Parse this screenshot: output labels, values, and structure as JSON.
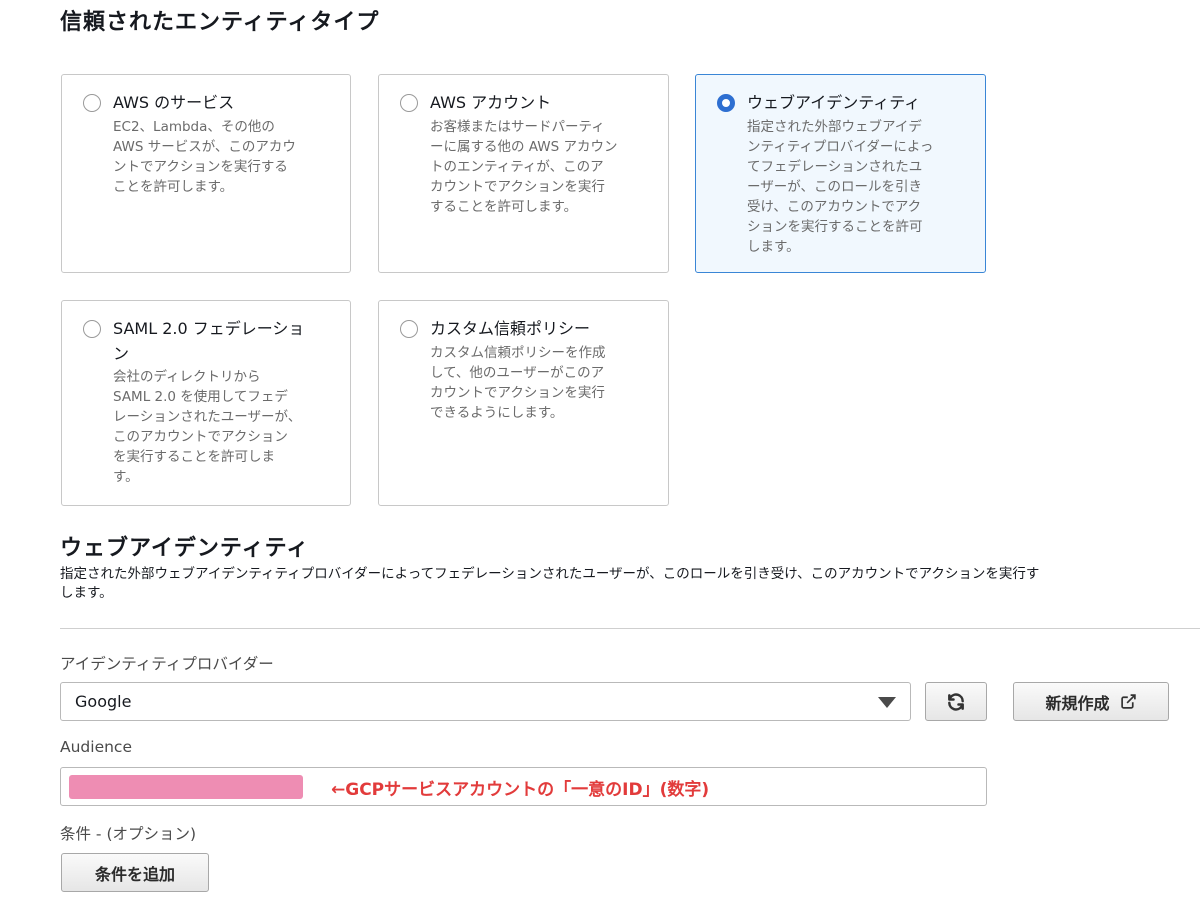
{
  "page_title": "信頼されたエンティティタイプ",
  "entity_types": [
    {
      "title": "AWS のサービス",
      "description": [
        "EC2、Lambda、その他の",
        "AWS サービスが、このアカウ",
        "ントでアクションを実行する",
        "ことを許可します。"
      ],
      "selected": false
    },
    {
      "title": "AWS アカウント",
      "description": [
        "お客様またはサードパーティ",
        "ーに属する他の AWS アカウン",
        "トのエンティティが、このア",
        "カウントでアクションを実行",
        "することを許可します。"
      ],
      "selected": false
    },
    {
      "title": "ウェブアイデンティティ",
      "description": [
        "指定された外部ウェブアイデ",
        "ンティティプロバイダーによっ",
        "てフェデレーションされたユ",
        "ーザーが、このロールを引き",
        "受け、このアカウントでアク",
        "ションを実行することを許可",
        "します。"
      ],
      "selected": true
    },
    {
      "title_lines": [
        "SAML 2.0 フェデレーショ",
        "ン"
      ],
      "description": [
        "会社のディレクトリから",
        "SAML 2.0 を使用してフェデ",
        "レーションされたユーザーが、",
        "このアカウントでアクション",
        "を実行することを許可しま",
        "す。"
      ],
      "selected": false
    },
    {
      "title": "カスタム信頼ポリシー",
      "description": [
        "カスタム信頼ポリシーを作成",
        "して、他のユーザーがこのア",
        "カウントでアクションを実行",
        "できるようにします。"
      ],
      "selected": false
    }
  ],
  "web_identity": {
    "heading": "ウェブアイデンティティ",
    "description_lines": [
      "指定された外部ウェブアイデンティティプロバイダーによってフェデレーションされたユーザーが、このロールを引き受け、このアカウントでアクションを実行す",
      "します。"
    ],
    "provider_label": "アイデンティティプロバイダー",
    "provider_value": "Google",
    "refresh_icon": "refresh-icon",
    "create_new_label": "新規作成",
    "external_link_icon": "external-link-icon",
    "audience_label": "Audience",
    "audience_annotation": "←GCPサービスアカウントの「一意のID」(数字)",
    "conditions_label": "条件 - (オプション)",
    "add_condition_label": "条件を追加"
  },
  "colors": {
    "selected_border": "#3a86d6",
    "selected_background": "#f1f8fe",
    "radio_checked": "#2e6fd1",
    "mask": "#ee8db3",
    "annotation": "#e23b3b"
  }
}
